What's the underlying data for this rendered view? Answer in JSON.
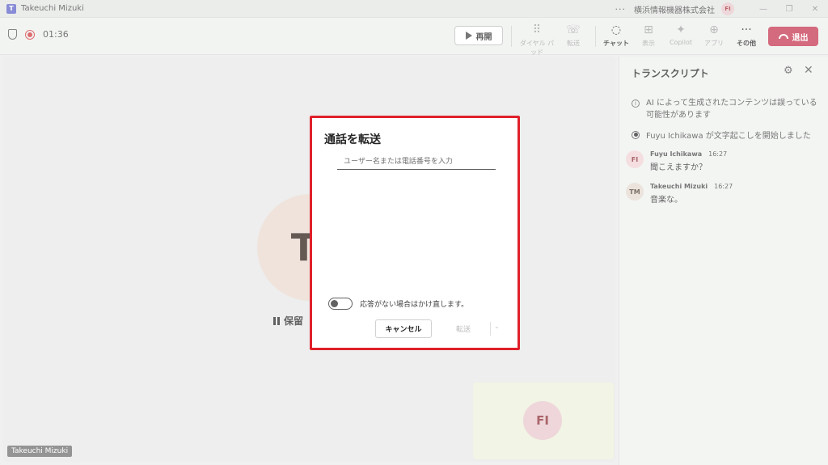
{
  "titlebar": {
    "app_title": "Takeuchi Mizuki",
    "more": "···",
    "org_name": "横浜情報機器株式会社",
    "user_initials": "FI",
    "minimize": "—",
    "maximize": "❐",
    "close": "✕"
  },
  "toolbar": {
    "timer": "01:36",
    "resume_label": "再開",
    "dialpad_label": "ダイヤル パッド",
    "transfer_label": "転送",
    "chat_label": "チャット",
    "view_label": "表示",
    "copilot_label": "Copilot",
    "apps_label": "アプリ",
    "more_label": "その他",
    "leave_label": "退出"
  },
  "stage": {
    "remote_initials": "TI",
    "hold_label": "保留",
    "remote_name": "Takeuchi Mizuki",
    "self_initials": "FI"
  },
  "transcript": {
    "title": "トランスクリプト",
    "ai_notice": "AI によって生成されたコンテンツは誤っている可能性があります",
    "started": "Fuyu Ichikawa が文字起こしを開始しました",
    "messages": [
      {
        "initials": "FI",
        "name": "Fuyu Ichikawa",
        "time": "16:27",
        "text": "聞こえますか？"
      },
      {
        "initials": "TM",
        "name": "Takeuchi Mizuki",
        "time": "16:27",
        "text": "音楽な。"
      }
    ]
  },
  "dialog": {
    "title": "通話を転送",
    "input_placeholder": "ユーザー名または電話番号を入力",
    "toggle_label": "応答がない場合はかけ直します。",
    "cancel_label": "キャンセル",
    "transfer_label": "転送"
  },
  "colors": {
    "leave": "#c4314b",
    "dialog_highlight": "#e0202a",
    "brand": "#5b5fc7"
  }
}
